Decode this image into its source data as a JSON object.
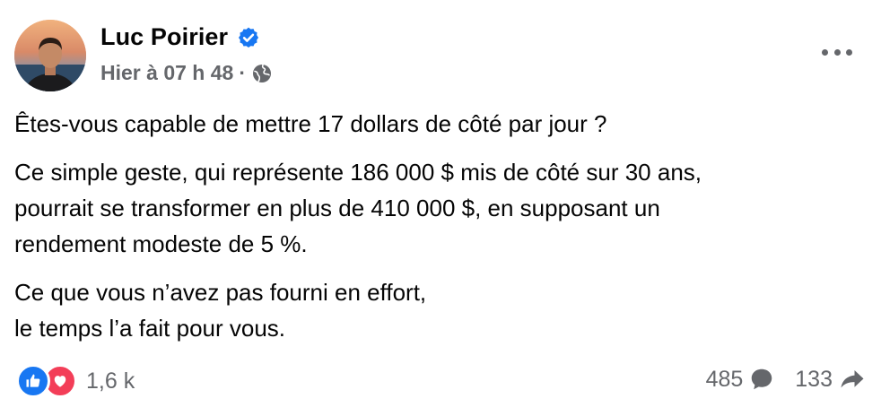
{
  "post": {
    "author": "Luc Poirier",
    "verified": true,
    "timestamp": "Hier à 07 h 48",
    "separator": "·",
    "audience_icon": "globe-icon",
    "paragraphs": [
      "Êtes-vous capable de mettre 17 dollars de côté par jour ?",
      "Ce simple geste, qui représente 186 000 $ mis de côté sur 30 ans,\npourrait se transformer en plus de 410 000 $, en supposant un\nrendement modeste de 5 %.",
      "Ce que vous n’avez pas fourni en effort,\nle temps l’a fait pour vous."
    ],
    "reactions": {
      "types": [
        "like-icon",
        "love-icon"
      ],
      "count": "1,6 k"
    },
    "comments_count": "485",
    "shares_count": "133"
  },
  "colors": {
    "primary_text": "#050505",
    "secondary_text": "#65676b",
    "like_blue": "#1877f2",
    "love_red": "#f33e58"
  }
}
